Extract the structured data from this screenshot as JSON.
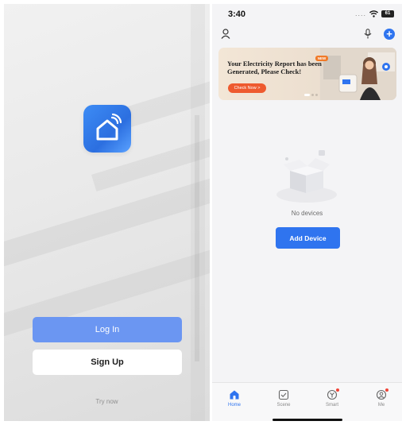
{
  "login": {
    "login_label": "Log In",
    "signup_label": "Sign Up",
    "try_now": "Try now",
    "app_icon": "smart-home-icon"
  },
  "home": {
    "status": {
      "time": "3:40",
      "signal": "....",
      "battery": "61"
    },
    "header": {
      "profile_icon": "person-icon",
      "mic_icon": "microphone-icon",
      "add_icon": "plus-icon"
    },
    "banner": {
      "title": "Your Electricity Report has been Generated, Please Check!",
      "badge": "NEW",
      "button": "Check Now >"
    },
    "empty": {
      "text": "No devices",
      "button": "Add Device"
    },
    "tabs": [
      {
        "label": "Home",
        "icon": "home-icon",
        "active": true
      },
      {
        "label": "Scene",
        "icon": "scene-check-icon",
        "active": false
      },
      {
        "label": "Smart",
        "icon": "smart-icon",
        "active": false
      },
      {
        "label": "Me",
        "icon": "me-icon",
        "active": false
      }
    ],
    "colors": {
      "accent": "#2f74ef",
      "login_button": "#6b96f2",
      "badge_dot": "#f04438"
    }
  }
}
